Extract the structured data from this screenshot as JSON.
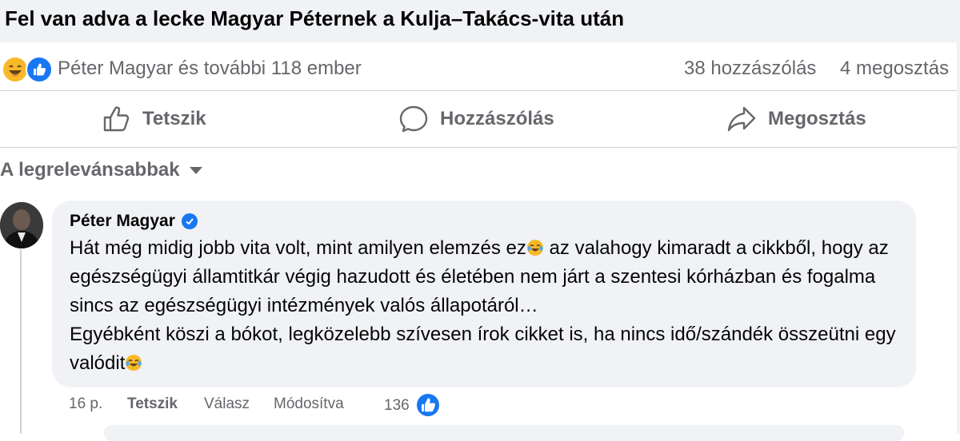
{
  "post": {
    "title": "Fel van adva a lecke Magyar Péternek a Kulja–Takács-vita után"
  },
  "stats": {
    "reactions_text": "Péter Magyar és további 118 ember",
    "comments_count": "38 hozzászólás",
    "shares_count": "4 megosztás"
  },
  "actions": {
    "like": "Tetszik",
    "comment": "Hozzászólás",
    "share": "Megosztás"
  },
  "sort": {
    "label": "A legrelevánsabbak"
  },
  "comment": {
    "author": "Péter Magyar",
    "text_part1": "Hát még midig jobb vita volt, mint amilyen elemzés ez",
    "text_part2": " az valahogy kimaradt a cikkből, hogy az egészségügyi államtitkár végig hazudott és életében nem járt a szentesi kórházban és fogalma sincs az egészségügyi intézmények valós állapotáról…",
    "text_part3": "Egyébként köszi a bókot, legközelebb szívesen írok cikket is, ha nincs idő/szándék összeütni egy valódit",
    "time": "16 p.",
    "like": "Tetszik",
    "reply": "Válasz",
    "edited": "Módosítva",
    "likes_count": "136"
  },
  "colors": {
    "accent": "#1877f2",
    "secondary_text": "#65676b",
    "bubble_bg": "#f0f2f5"
  }
}
